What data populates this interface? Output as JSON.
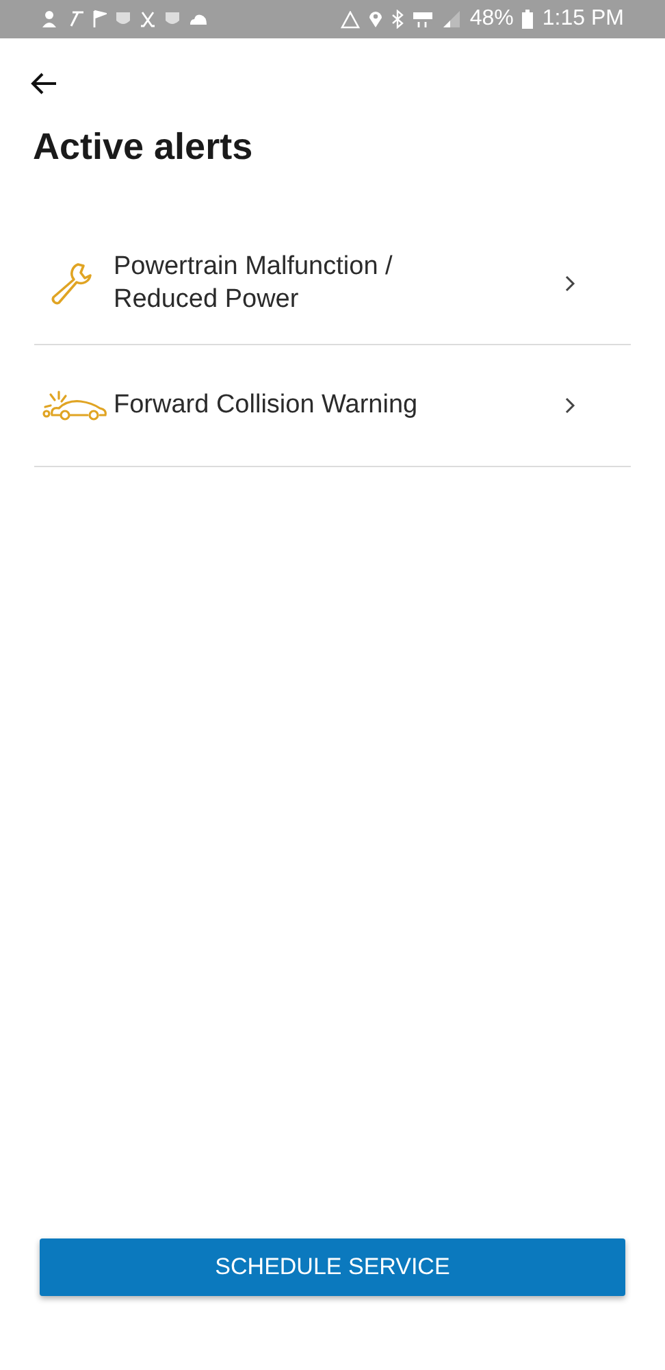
{
  "status_bar": {
    "battery": "48%",
    "time": "1:15 PM"
  },
  "title": "Active alerts",
  "alerts": [
    {
      "kind": "wrench",
      "label": "Powertrain Malfunction / Reduced Power"
    },
    {
      "kind": "collision",
      "label": "Forward Collision Warning"
    }
  ],
  "button": "SCHEDULE SERVICE"
}
